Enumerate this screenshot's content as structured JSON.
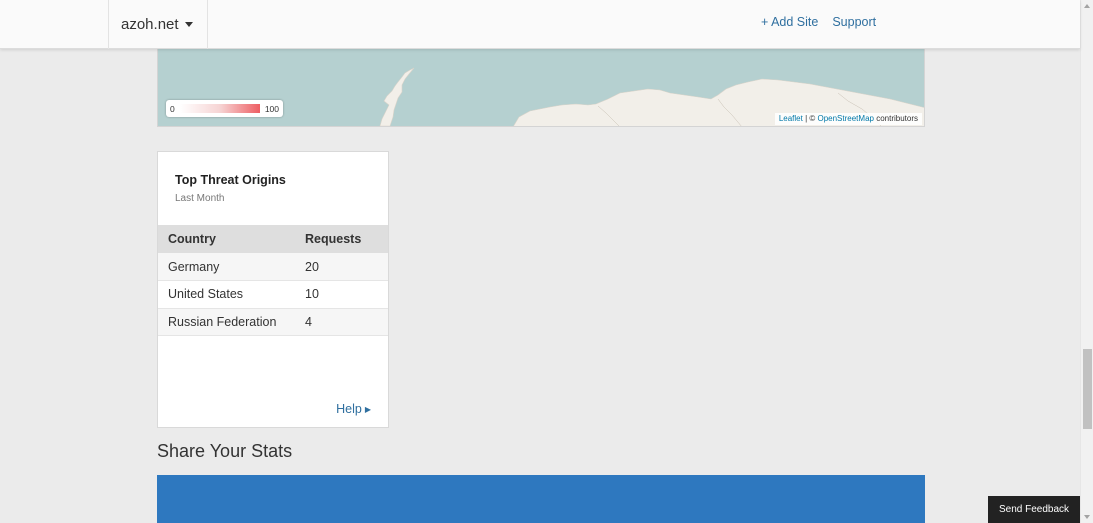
{
  "header": {
    "site_name": "azoh.net",
    "links": {
      "add_site": "+ Add Site",
      "support": "Support"
    }
  },
  "map": {
    "legend": {
      "min": "0",
      "max": "100"
    },
    "attribution": {
      "leaflet": "Leaflet",
      "separator": " | © ",
      "osm": "OpenStreetMap",
      "suffix": " contributors"
    },
    "colors": {
      "water": "#b5d0d0",
      "land": "#f2efe9",
      "heat_high": "#ee5e63"
    }
  },
  "threat_origins": {
    "title": "Top Threat Origins",
    "subtitle": "Last Month",
    "columns": [
      "Country",
      "Requests"
    ],
    "rows": [
      [
        "Germany",
        "20"
      ],
      [
        "United States",
        "10"
      ],
      [
        "Russian Federation",
        "4"
      ]
    ],
    "help_label": "Help"
  },
  "share": {
    "heading": "Share Your Stats",
    "banner_color": "#2e78bf"
  },
  "feedback": {
    "label": "Send Feedback"
  }
}
